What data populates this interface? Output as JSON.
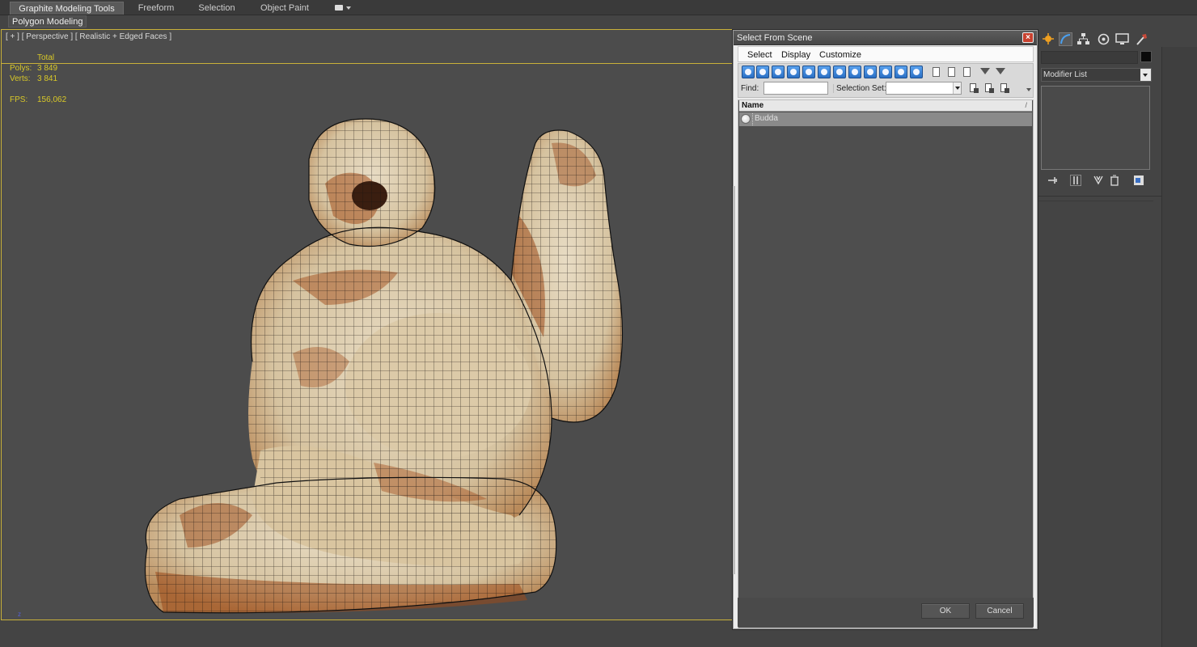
{
  "ribbon": {
    "tabs": [
      {
        "label": "Graphite Modeling Tools",
        "active": true
      },
      {
        "label": "Freeform",
        "active": false
      },
      {
        "label": "Selection",
        "active": false
      },
      {
        "label": "Object Paint",
        "active": false
      }
    ],
    "extra_menu_icon": "display-options-icon",
    "subtab": "Polygon Modeling"
  },
  "viewport": {
    "label": "[ + ] [ Perspective ] [ Realistic + Edged Faces ]",
    "stats": {
      "total_label": "Total",
      "polys_label": "Polys:",
      "polys_value": "3 849",
      "verts_label": "Verts:",
      "verts_value": "3 841",
      "fps_label": "FPS:",
      "fps_value": "156,062"
    },
    "axis_label": "z",
    "colors": {
      "active_border": "#c9b13a",
      "stats_text": "#d8c828"
    }
  },
  "dialog": {
    "title": "Select From Scene",
    "close_glyph": "×",
    "menu": [
      "Select",
      "Display",
      "Customize"
    ],
    "find_label": "Find:",
    "find_value": "",
    "selection_set_label": "Selection Set:",
    "selection_set_value": "",
    "list": {
      "column_name": "Name",
      "sort_glyph": "/",
      "rows": [
        {
          "name": "Budda",
          "icon": "geometry-sphere-icon"
        }
      ]
    },
    "ok_label": "OK",
    "cancel_label": "Cancel"
  },
  "command_panel": {
    "tab_icons": [
      "create-icon",
      "modify-icon",
      "hierarchy-icon",
      "motion-icon",
      "display-icon",
      "utilities-icon"
    ],
    "modifier_list_label": "Modifier List",
    "object_color": "#0a0a0a"
  }
}
